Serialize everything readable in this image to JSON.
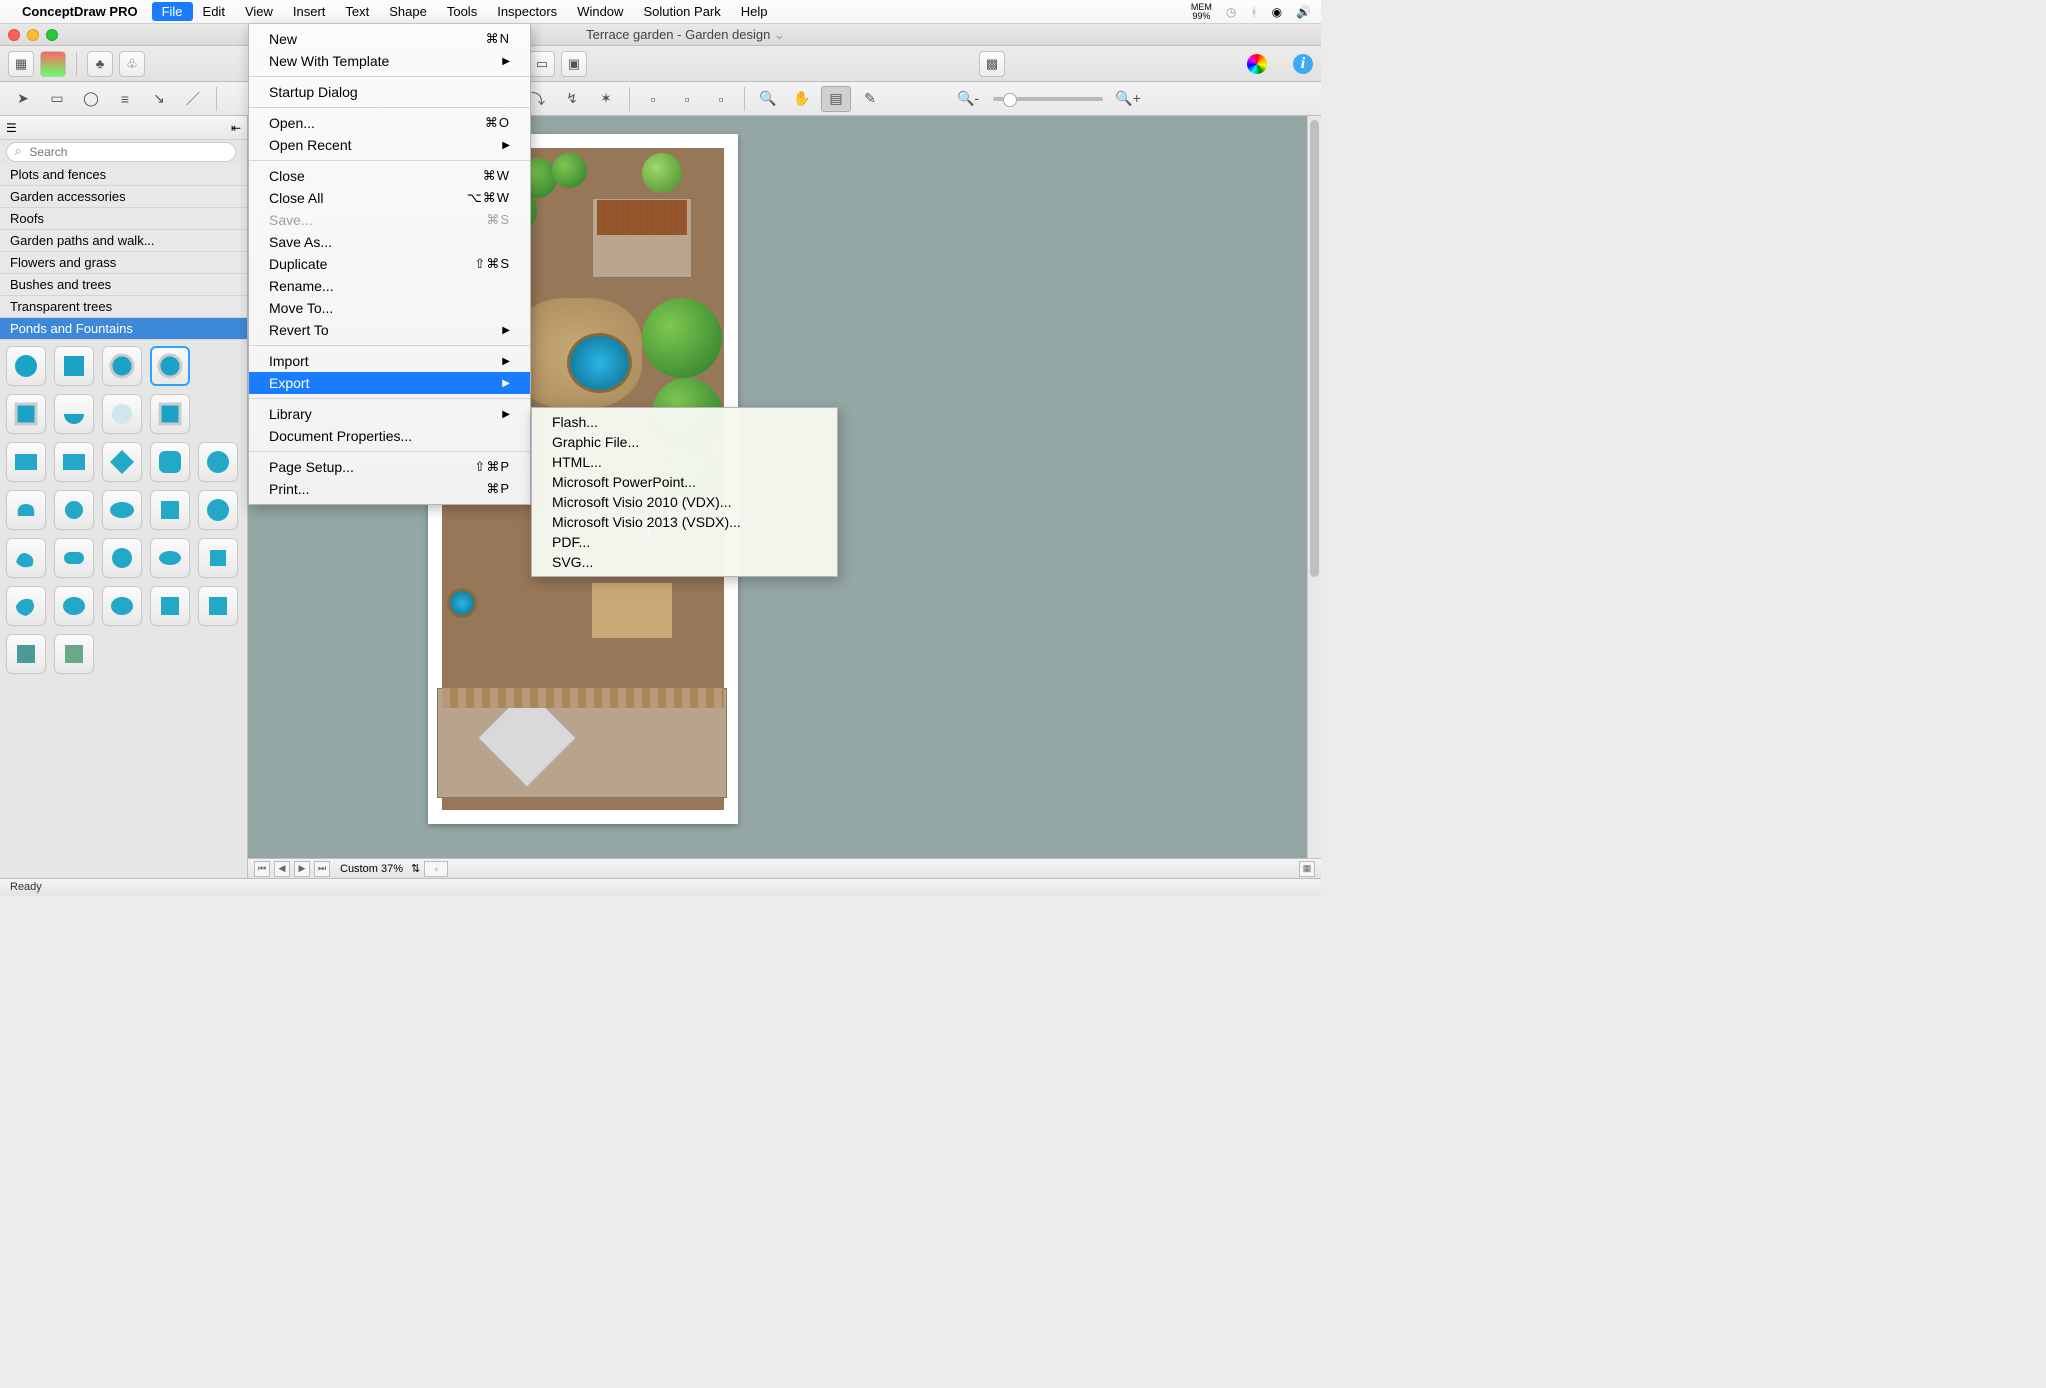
{
  "menubar": {
    "appname": "ConceptDraw PRO",
    "items": [
      "File",
      "Edit",
      "View",
      "Insert",
      "Text",
      "Shape",
      "Tools",
      "Inspectors",
      "Window",
      "Solution Park",
      "Help"
    ],
    "active": "File",
    "mem_label": "MEM",
    "mem_value": "99%"
  },
  "window": {
    "title": "Terrace garden - Garden design"
  },
  "file_menu": [
    {
      "label": "New",
      "shortcut": "⌘N"
    },
    {
      "label": "New With Template",
      "submenu": true
    },
    {
      "sep": true
    },
    {
      "label": "Startup Dialog"
    },
    {
      "sep": true
    },
    {
      "label": "Open...",
      "shortcut": "⌘O"
    },
    {
      "label": "Open Recent",
      "submenu": true
    },
    {
      "sep": true
    },
    {
      "label": "Close",
      "shortcut": "⌘W"
    },
    {
      "label": "Close All",
      "shortcut": "⌥⌘W"
    },
    {
      "label": "Save...",
      "shortcut": "⌘S",
      "disabled": true
    },
    {
      "label": "Save As..."
    },
    {
      "label": "Duplicate",
      "shortcut": "⇧⌘S"
    },
    {
      "label": "Rename..."
    },
    {
      "label": "Move To..."
    },
    {
      "label": "Revert To",
      "submenu": true
    },
    {
      "sep": true
    },
    {
      "label": "Import",
      "submenu": true
    },
    {
      "label": "Export",
      "submenu": true,
      "highlight": true
    },
    {
      "sep": true
    },
    {
      "label": "Library",
      "submenu": true
    },
    {
      "label": "Document Properties..."
    },
    {
      "sep": true
    },
    {
      "label": "Page Setup...",
      "shortcut": "⇧⌘P"
    },
    {
      "label": "Print...",
      "shortcut": "⌘P"
    }
  ],
  "export_submenu": [
    "Flash...",
    "Graphic File...",
    "HTML...",
    "Microsoft PowerPoint...",
    "Microsoft Visio 2010 (VDX)...",
    "Microsoft Visio 2013 (VSDX)...",
    "PDF...",
    "SVG..."
  ],
  "sidebar": {
    "search_placeholder": "Search",
    "libraries": [
      "Plots and fences",
      "Garden accessories",
      "Roofs",
      "Garden paths and walk...",
      "Flowers and grass",
      "Bushes and trees",
      "Transparent trees",
      "Ponds and Fountains"
    ],
    "selected_library": "Ponds and Fountains"
  },
  "pagebar": {
    "zoom_label": "Custom 37%"
  },
  "status": {
    "text": "Ready"
  }
}
